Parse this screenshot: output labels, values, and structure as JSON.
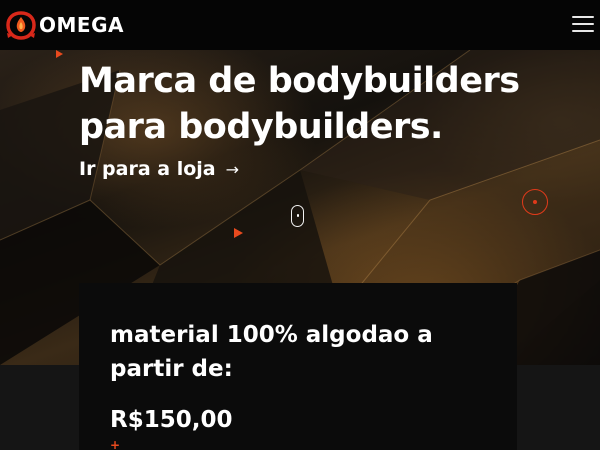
{
  "header": {
    "brand": "OMEGA",
    "logo_icon": "omega-flame-logo",
    "menu_icon": "hamburger-icon"
  },
  "hero": {
    "title": "Marca de bodybuilders para bodybuilders.",
    "cta_label": "Ir para a loja",
    "cta_arrow": "→"
  },
  "promo": {
    "title": "material 100% algodao a partir de:",
    "price": "R$150,00",
    "plus": "+"
  },
  "colors": {
    "accent": "#e84a1e",
    "background": "#050505",
    "card": "#0b0b0b"
  }
}
